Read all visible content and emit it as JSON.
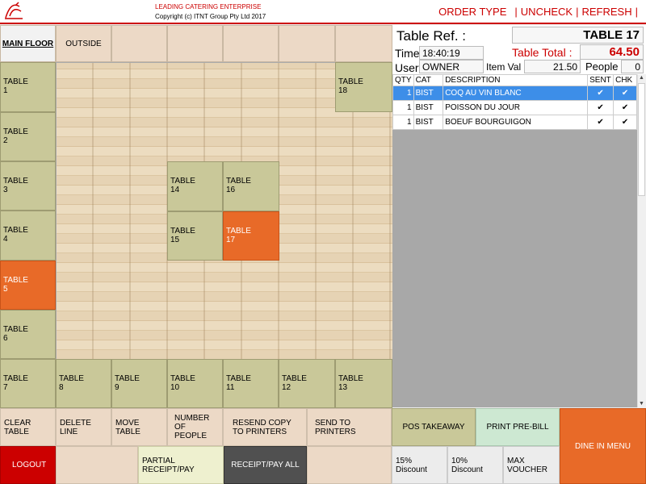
{
  "header": {
    "company": "LEADING CATERING ENTERPRISE",
    "copyright": "Copyright (c) ITNT Group Pty Ltd 2017",
    "nav": {
      "order_type": "ORDER TYPE",
      "uncheck": "UNCHECK",
      "refresh": "REFRESH",
      "sep": "|"
    }
  },
  "tabs": {
    "main_floor": "MAIN FLOOR",
    "outside": "OUTSIDE"
  },
  "tables": {
    "word": "TABLE",
    "t1": "1",
    "t2": "2",
    "t3": "3",
    "t4": "4",
    "t5": "5",
    "t6": "6",
    "t7": "7",
    "t8": "8",
    "t9": "9",
    "t10": "10",
    "t11": "11",
    "t12": "12",
    "t13": "13",
    "t14": "14",
    "t15": "15",
    "t16": "16",
    "t17": "17",
    "t18": "18",
    "selected": [
      "5",
      "17"
    ]
  },
  "order": {
    "table_ref_label": "Table Ref. :",
    "table_ref": "TABLE 17",
    "time_label": "Time",
    "time": "18:40:19",
    "total_label": "Table Total :",
    "total": "64.50",
    "user_label": "User",
    "user": "OWNER",
    "item_val_label": "Item Val",
    "item_val": "21.50",
    "people_label": "People",
    "people": "0",
    "columns": {
      "qty": "QTY",
      "cat": "CAT",
      "desc": "DESCRIPTION",
      "sent": "SENT",
      "chk": "CHK"
    },
    "items": [
      {
        "qty": "1",
        "cat": "BIST",
        "desc": "COQ AU VIN BLANC",
        "sent": "✔",
        "chk": "✔"
      },
      {
        "qty": "1",
        "cat": "BIST",
        "desc": "POISSON DU JOUR",
        "sent": "✔",
        "chk": "✔"
      },
      {
        "qty": "1",
        "cat": "BIST",
        "desc": "BOEUF BOURGUIGON",
        "sent": "✔",
        "chk": "✔"
      }
    ]
  },
  "actions": {
    "clear_table": "CLEAR TABLE",
    "delete_line": "DELETE LINE",
    "move_table": "MOVE TABLE",
    "number_of_people": "NUMBER OF PEOPLE",
    "resend_copy": "RESEND COPY TO PRINTERS",
    "send_to_printers": "SEND TO PRINTERS",
    "pos_takeaway": "POS TAKEAWAY",
    "print_pre_bill": "PRINT PRE-BILL",
    "dine_in_menu": "DINE IN MENU",
    "logout": "LOGOUT",
    "partial_receipt": "PARTIAL RECEIPT/PAY",
    "receipt_pay_all": "RECEIPT/PAY ALL",
    "discount_15": "15% Discount",
    "discount_10": "10% Discount",
    "max_voucher": "MAX VOUCHER"
  },
  "colors": {
    "accent_red": "#cc0000",
    "table_selected": "#e86a28",
    "table_idle": "#c9c899",
    "logout": "#cc0000",
    "receipt_all": "#505050"
  }
}
